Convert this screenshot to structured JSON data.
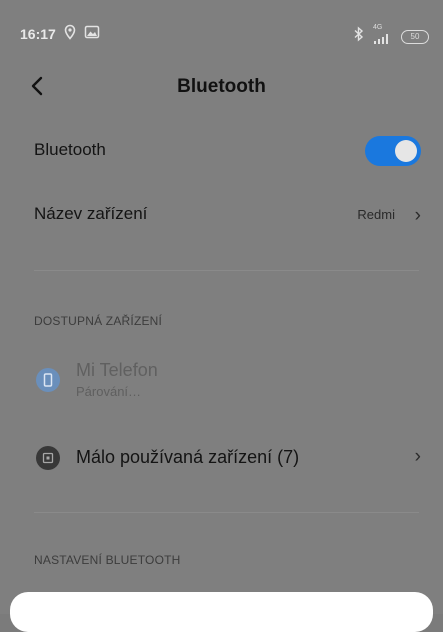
{
  "status_bar": {
    "time": "16:17",
    "battery": "50",
    "network": "4G",
    "icons": [
      "location-icon",
      "gallery-icon",
      "bluetooth-icon",
      "signal-icon",
      "battery-icon"
    ]
  },
  "header": {
    "title": "Bluetooth",
    "back_icon": "chevron-left-icon"
  },
  "bluetooth_row": {
    "label": "Bluetooth",
    "enabled": true,
    "accent": "#1a78de"
  },
  "device_name_row": {
    "label": "Název zařízení",
    "value": "Redmi"
  },
  "available_devices": {
    "header": "DOSTUPNÁ ZAŘÍZENÍ",
    "items": [
      {
        "name": "Mi Telefon",
        "status": "Párování…",
        "icon": "phone-icon"
      },
      {
        "name": "Málo používaná zařízení (7)",
        "icon": "device-icon"
      }
    ]
  },
  "bluetooth_settings": {
    "header": "NASTAVENÍ BLUETOOTH"
  }
}
